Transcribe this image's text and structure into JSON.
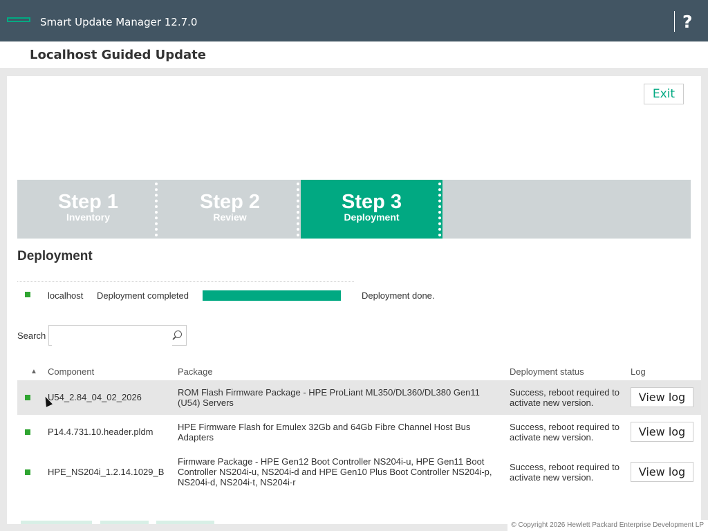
{
  "app": {
    "title": "Smart Update Manager 12.7.0",
    "help_label": "?"
  },
  "page": {
    "title": "Localhost Guided Update",
    "exit_label": "Exit"
  },
  "steps": [
    {
      "number": "Step 1",
      "label": "Inventory",
      "active": false
    },
    {
      "number": "Step 2",
      "label": "Review",
      "active": false
    },
    {
      "number": "Step 3",
      "label": "Deployment",
      "active": true
    }
  ],
  "section": {
    "title": "Deployment"
  },
  "host": {
    "name": "localhost",
    "status": "Deployment completed",
    "progress_percent": 100,
    "result": "Deployment done.",
    "status_color": "#2fa531"
  },
  "search": {
    "label": "Search",
    "value": "",
    "placeholder": ""
  },
  "table": {
    "sort_indicator": "▲",
    "headers": [
      "Component",
      "Package",
      "Deployment status",
      "Log"
    ],
    "rows": [
      {
        "component": "U54_2.84_04_02_2026",
        "package": "ROM Flash Firmware Package - HPE ProLiant ML350/DL360/DL380 Gen11 (U54) Servers",
        "status": "Success, reboot required to activate new version.",
        "log_label": "View log"
      },
      {
        "component": "P14.4.731.10.header.pldm",
        "package": "HPE Firmware Flash for Emulex 32Gb and 64Gb Fibre Channel Host Bus Adapters",
        "status": "Success, reboot required to activate new version.",
        "log_label": "View log"
      },
      {
        "component": "HPE_NS204i_1.2.14.1029_B",
        "package": "Firmware Package - HPE Gen12 Boot Controller NS204i-u, HPE Gen11 Boot Controller NS204i-u, NS204i-d and HPE Gen10 Plus Boot Controller NS204i-p, NS204i-d, NS204i-t, NS204i-r",
        "status": "Success, reboot required to activate new version.",
        "log_label": "View log"
      }
    ]
  },
  "footer": {
    "copyright": "© Copyright 2026 Hewlett Packard Enterprise Development LP"
  },
  "colors": {
    "accent": "#01a982",
    "topbar": "#425563",
    "steps_bg": "#ced4d6"
  }
}
